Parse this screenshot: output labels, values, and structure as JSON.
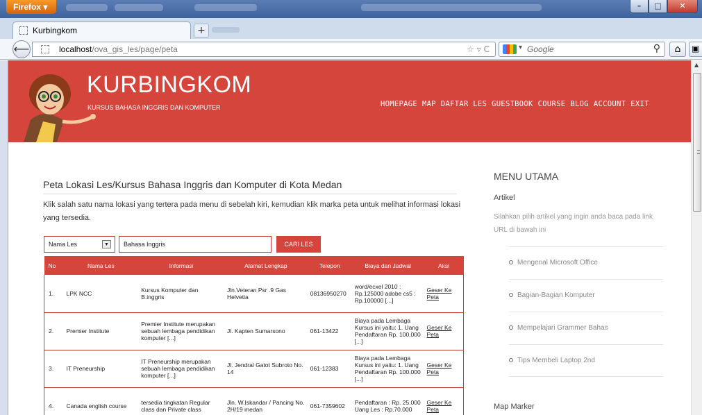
{
  "browser": {
    "app_button": "Firefox",
    "tab_title": "Kurbingkom",
    "new_tab": "+",
    "url_host": "localhost",
    "url_path": "/ova_gis_les/page/peta",
    "search_placeholder": "Google"
  },
  "site": {
    "title": "KURBINGKOM",
    "tagline": "KURSUS BAHASA INGGRIS DAN KOMPUTER",
    "nav": [
      "HOMEPAGE",
      "MAP",
      "DAFTAR LES",
      "GUESTBOOK",
      "COURSE",
      "BLOG",
      "ACCOUNT",
      "EXIT"
    ]
  },
  "main": {
    "heading": "Peta Lokasi Les/Kursus Bahasa Inggris dan Komputer di Kota Medan",
    "intro": "Klik salah satu nama lokasi yang tertera pada menu di sebelah kiri, kemudian klik marka peta untuk melihat informasi lokasi yang tersedia.",
    "filter": {
      "select_value": "Nama Les",
      "search_value": "Bahasa Inggris",
      "button_label": "CARI LES"
    },
    "table": {
      "columns": [
        "No",
        "Nama Les",
        "Informasi",
        "Alamat Lengkap",
        "Telepon",
        "Biaya dan Jadwal",
        "Aksi"
      ],
      "rows": [
        {
          "no": "1.",
          "nama": "LPK NCC",
          "informasi": "Kursus Komputer dan B.inggris",
          "alamat": "Jln.Veteran Psr .9 Gas Helvetia",
          "telepon": "08136950270",
          "biaya": "word/ecxel 2010 : Rp.125000 adobe cs5 : Rp.100000 [...]",
          "aksi": "Geser Ke Peta"
        },
        {
          "no": "2.",
          "nama": "Premier Institute",
          "informasi": "Premier Institute merupakan sebuah lembaga pendidikan komputer [...]",
          "alamat": "Jl. Kapten Sumarsono",
          "telepon": "061-13422",
          "biaya": "Biaya pada Lembaga Kursus ini yaitu: 1. Uang Pendaftaran Rp. 100.000 [...]",
          "aksi": "Geser Ke Peta"
        },
        {
          "no": "3.",
          "nama": "IT Preneurship",
          "informasi": "IT Preneurship merupakan sebuah lembaga pendidikan komputer [...]",
          "alamat": "Jl. Jendral Gatot Subroto No. 14",
          "telepon": "061-12383",
          "biaya": "Biaya pada Lembaga Kursus ini yaitu: 1. Uang Pendaftaran Rp. 100.000 [...]",
          "aksi": "Geser Ke Peta"
        },
        {
          "no": "4.",
          "nama": "Canada english course",
          "informasi": "tersedia tingkatan Regular class dan Private class",
          "alamat": "Jln. W.Iskandar / Pancing No. 2H/19 medan",
          "telepon": "061-7359602",
          "biaya": "Pendaftaran : Rp. 25.000 Uang Les : Rp.70.000",
          "aksi": "Geser Ke Peta"
        }
      ]
    }
  },
  "sidebar": {
    "title": "MENU UTAMA",
    "artikel_heading": "Artikel",
    "artikel_desc": "Silahkan pilih artikel yang ingin anda baca pada link URL di bawah ini",
    "artikel_items": [
      "Mengenal Microsoft Office",
      "Bagian-Bagian Komputer",
      "Mempelajari Grammer Bahas",
      "Tips Membeli Laptop 2nd"
    ],
    "map_marker_heading": "Map Marker"
  },
  "colors": {
    "brand_red": "#d6453b"
  }
}
